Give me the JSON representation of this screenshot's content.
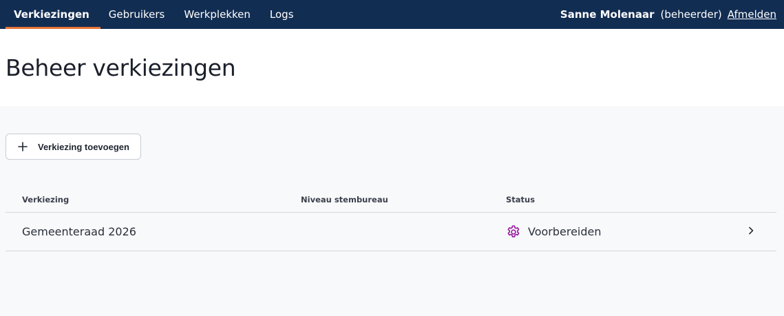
{
  "nav": {
    "tabs": [
      {
        "label": "Verkiezingen",
        "active": true
      },
      {
        "label": "Gebruikers",
        "active": false
      },
      {
        "label": "Werkplekken",
        "active": false
      },
      {
        "label": "Logs",
        "active": false
      }
    ],
    "user_name": "Sanne Molenaar",
    "user_role": "(beheerder)",
    "logout_label": "Afmelden"
  },
  "page": {
    "title": "Beheer verkiezingen"
  },
  "toolbar": {
    "add_label": "Verkiezing toevoegen",
    "add_icon": "plus-icon"
  },
  "table": {
    "headers": {
      "name": "Verkiezing",
      "level": "Niveau stembureau",
      "status": "Status"
    },
    "rows": [
      {
        "name": "Gemeenteraad 2026",
        "level": "",
        "status": "Voorbereiden",
        "status_icon": "gear-icon"
      }
    ]
  },
  "colors": {
    "nav_bg": "#122d52",
    "active_underline": "#e8743b",
    "status_icon": "#9b1fa3",
    "page_bg": "#f8f9fa"
  }
}
